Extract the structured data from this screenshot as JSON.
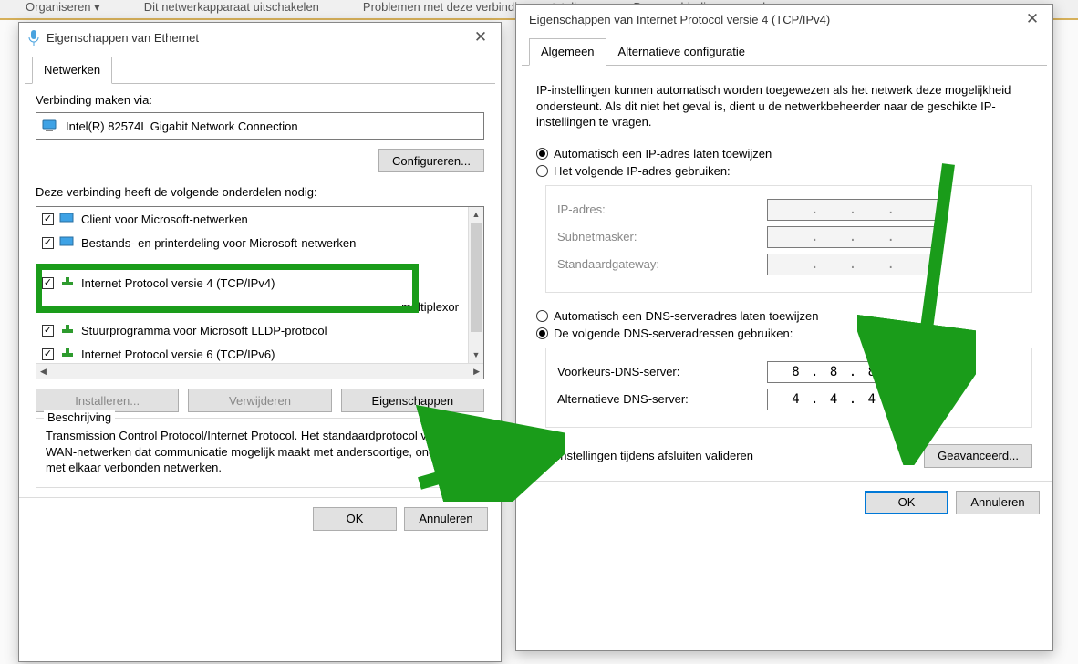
{
  "toolbar": {
    "items": [
      "Organiseren ▾",
      "Dit netwerkapparaat uitschakelen",
      "Problemen met deze verbinding vaststellen",
      "Deze verbinding een andere naam geven"
    ]
  },
  "left": {
    "title": "Eigenschappen van Ethernet",
    "tab": "Netwerken",
    "connect_via_label": "Verbinding maken via:",
    "adapter_name": "Intel(R) 82574L Gigabit Network Connection",
    "configure_btn": "Configureren...",
    "uses_label": "Deze verbinding heeft de volgende onderdelen nodig:",
    "components": [
      {
        "label": "Client voor Microsoft-netwerken",
        "checked": true,
        "icon": "client"
      },
      {
        "label": "Bestands- en printerdeling voor Microsoft-netwerken",
        "checked": true,
        "icon": "share"
      },
      {
        "label": "",
        "checked": false,
        "icon": "none",
        "obscured": true
      },
      {
        "label": "Internet Protocol versie 4 (TCP/IPv4)",
        "checked": true,
        "icon": "protocol"
      },
      {
        "label": "Microsoft-protocol voor netwerkadapter-multiplexor",
        "checked": false,
        "icon": "protocol",
        "second_part": "multiplexor"
      },
      {
        "label": "Stuurprogramma voor Microsoft LLDP-protocol",
        "checked": true,
        "icon": "protocol"
      },
      {
        "label": "Internet Protocol versie 6 (TCP/IPv6)",
        "checked": true,
        "icon": "protocol"
      }
    ],
    "install_btn": "Installeren...",
    "uninstall_btn": "Verwijderen",
    "properties_btn": "Eigenschappen",
    "desc_legend": "Beschrijving",
    "desc_text": "Transmission Control Protocol/Internet Protocol. Het standaardprotocol voor WAN-netwerken dat communicatie mogelijk maakt met andersoortige, onderling met elkaar verbonden netwerken.",
    "ok_btn": "OK",
    "cancel_btn": "Annuleren"
  },
  "right": {
    "title": "Eigenschappen van Internet Protocol versie 4 (TCP/IPv4)",
    "tab1": "Algemeen",
    "tab2": "Alternatieve configuratie",
    "description": "IP-instellingen kunnen automatisch worden toegewezen als het netwerk deze mogelijkheid ondersteunt. Als dit niet het geval is, dient u de netwerkbeheerder naar de geschikte IP-instellingen te vragen.",
    "ip_auto": "Automatisch een IP-adres laten toewijzen",
    "ip_manual": "Het volgende IP-adres gebruiken:",
    "ip_label": "IP-adres:",
    "mask_label": "Subnetmasker:",
    "gw_label": "Standaardgateway:",
    "dns_auto": "Automatisch een DNS-serveradres laten toewijzen",
    "dns_manual": "De volgende DNS-serveradressen gebruiken:",
    "dns_pref_label": "Voorkeurs-DNS-server:",
    "dns_alt_label": "Alternatieve DNS-server:",
    "dns_pref_value": "8 . 8 . 8 . 8",
    "dns_alt_value": "4 . 4 . 4 . 4",
    "validate_label": "Instellingen tijdens afsluiten valideren",
    "advanced_btn": "Geavanceerd...",
    "ok_btn": "OK",
    "cancel_btn": "Annuleren"
  }
}
